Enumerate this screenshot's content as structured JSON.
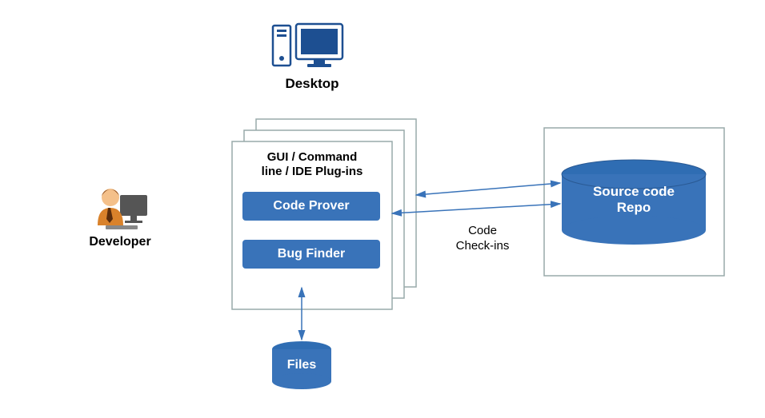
{
  "desktop_label": "Desktop",
  "developer_label": "Developer",
  "panel_heading_l1": "GUI / Command",
  "panel_heading_l2": "line / IDE Plug-ins",
  "code_prover_label": "Code Prover",
  "bug_finder_label": "Bug Finder",
  "files_label": "Files",
  "source_code_repo_l1": "Source code",
  "source_code_repo_l2": "Repo",
  "code_checkins_l1": "Code",
  "code_checkins_l2": "Check-ins"
}
